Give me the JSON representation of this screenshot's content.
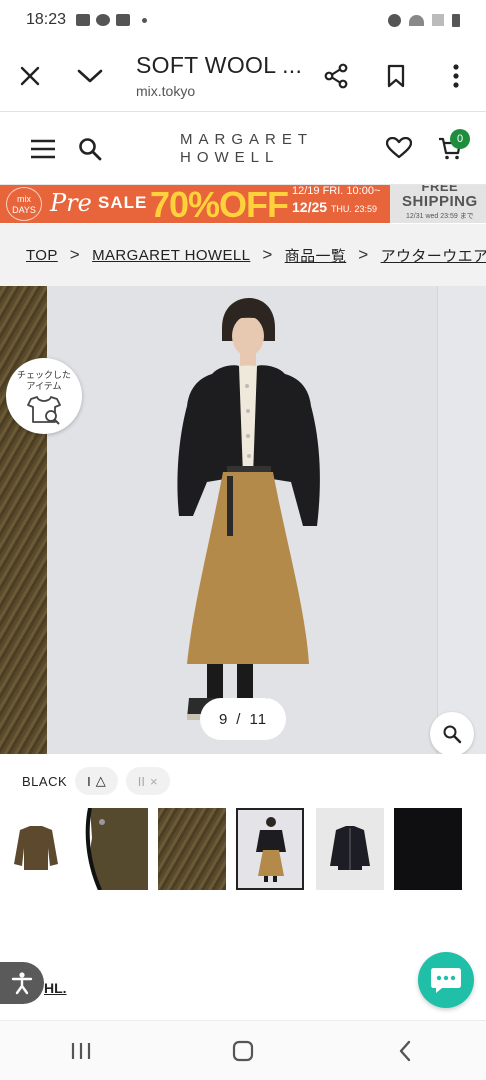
{
  "status_bar": {
    "time": "18:23"
  },
  "browser": {
    "title": "SOFT WOOL ...",
    "url": "mix.tokyo"
  },
  "site": {
    "logo_line1": "MARGARET",
    "logo_line2": "HOWELL",
    "cart_count": "0"
  },
  "banner": {
    "mix_label": "mix DAYS",
    "pre": "Pre",
    "sale": "SALE",
    "discount": "70%OFF",
    "date1": "12/19 FRI. 10:00~",
    "date2": "12/25",
    "date2_suffix": "THU. 23:59",
    "free": "FREE",
    "shipping": "SHIPPING",
    "shipping_note": "12/31 wed 23:59 まで"
  },
  "breadcrumb": [
    {
      "label": "TOP"
    },
    {
      "label": "MARGARET HOWELL"
    },
    {
      "label": "商品一覧"
    },
    {
      "label": "アウターウエア"
    }
  ],
  "gallery": {
    "check_label_1": "チェックした",
    "check_label_2": "アイテム",
    "current": "9",
    "separator": "/",
    "total": "11"
  },
  "variant": {
    "color": "BLACK",
    "sizes": [
      {
        "label": "I",
        "status": "△"
      },
      {
        "label": "II",
        "status": "×"
      }
    ]
  },
  "footer_link": "HL.",
  "colors": {
    "accent_green": "#1e8e3e",
    "banner_orange": "#e8643a",
    "chat_teal": "#1fbfa8"
  }
}
